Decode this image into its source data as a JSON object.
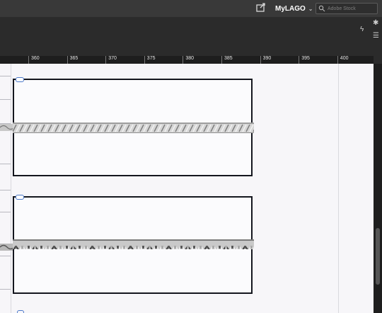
{
  "header": {
    "account_name": "MyLAGO",
    "search_placeholder": "Adobe Stock",
    "icons": [
      "share-icon",
      "chevron-down-icon",
      "search-icon",
      "gear-icon",
      "bolt-icon",
      "menu-icon"
    ]
  },
  "ruler": {
    "labels": [
      "360",
      "365",
      "370",
      "375",
      "380",
      "385",
      "390",
      "395",
      "400"
    ]
  },
  "artboards": [
    {
      "name": "artboard-1",
      "chain_style": "fine"
    },
    {
      "name": "artboard-2",
      "chain_style": "coarse"
    }
  ],
  "colors": {
    "accent": "#4a78c9",
    "canvas": "#f7f6f9",
    "frame_border": "#14161e"
  }
}
